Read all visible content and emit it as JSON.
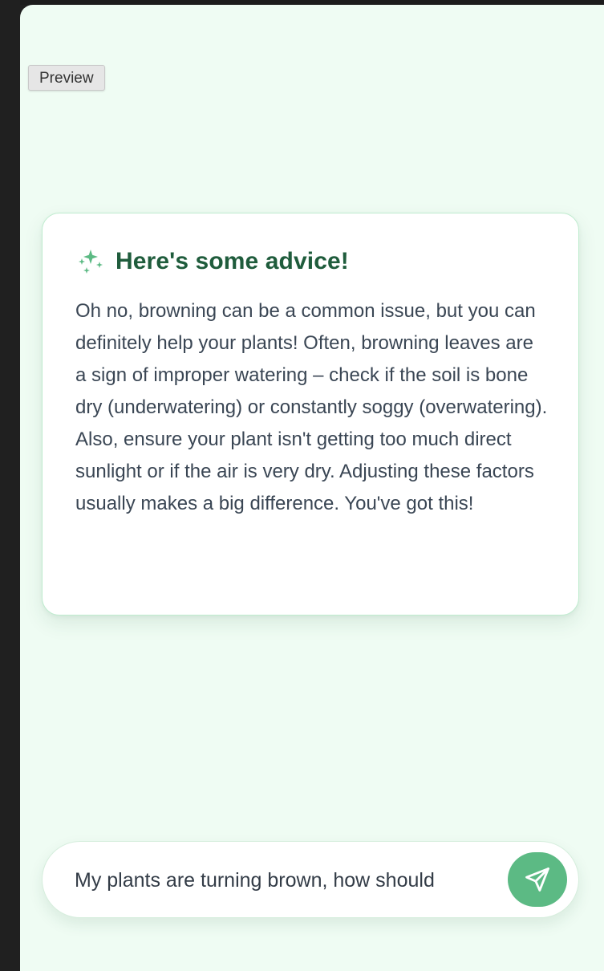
{
  "preview": {
    "label": "Preview"
  },
  "advice_card": {
    "icon": "sparkles-icon",
    "title": "Here's some advice!",
    "body": "Oh no, browning can be a common issue, but you can definitely help your plants! Often, browning leaves are a sign of improper watering – check if the soil is bone dry (underwatering) or constantly soggy (overwatering). Also, ensure your plant isn't getting too much direct sunlight or if the air is very dry. Adjusting these factors usually makes a big difference. You've got this!"
  },
  "chat_input": {
    "value": "My plants are turning brown, how should",
    "send_icon": "paper-plane-send-icon"
  },
  "colors": {
    "background": "#effcf3",
    "title": "#1f5c3c",
    "accent": "#5cba84",
    "body_text": "#3a4654",
    "card_border": "#bfeccf"
  }
}
